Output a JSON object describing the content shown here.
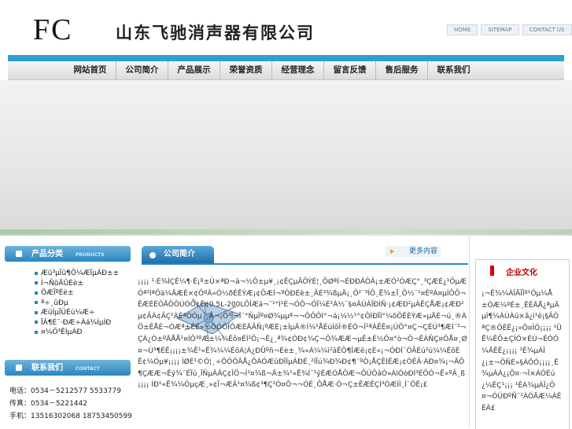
{
  "header": {
    "logo": "FC",
    "company_name": "山东飞驰消声器有限公司",
    "top_links": [
      "HOME",
      "SITEMAP",
      "CONTACT US"
    ]
  },
  "nav": {
    "items": [
      "网站首页",
      "公司简介",
      "产品展示",
      "荣誉资质",
      "经营理念",
      "留言反馈",
      "售后服务",
      "联系我们"
    ]
  },
  "sidebar": {
    "products": {
      "title": "产品分类",
      "title_en": "PRODUCTS",
      "items": [
        "Æû³µÏû¶Ô¼ÆÏµÁÐ±±",
        "Ì¬ÑöÄÛÈè±",
        "ÖÆÏºÈè±",
        "ª÷¸ûÐµ",
        "ÆûÍµÏÜÉù¼Æ÷",
        "ÏÂ¶É¨·ÐÆ÷Àá¼ÍµÍÐ",
        "¤¼Ö³ÊÍµÀÐ"
      ]
    },
    "contact": {
      "title": "联系我们",
      "title_en": "CONTACT",
      "lines": [
        "电话：0534－5212577  5533779",
        "传真：0534－5221442",
        "手机：13516302068  18753450599"
      ]
    }
  },
  "main": {
    "intro_title": "公司简介",
    "more_label": "更多内容",
    "intro_text": "¡¡¡¡ ¹·É¾ÍÇÊ¼¶·Ê¡º±Ù×ªÐ¬ä¬½Õ±µ¥¸¡¢ÊÇµÄÖÝÉ¦¸ÕØªÍ¬ÉÐÐÂÒÂ¡±ÆÓ²ÒÆÇ°¸³ÇÆÈ¿¹ÖµÆÓª²ÍªÔä¼ÄÆÈ×¢ÖºÂ»Ó½ðÉÊÝÆ¡¢ÔÆÍ¬ºÒÐÈè±¸ÃÉ³¾ßµÄ¡¸Ô²¨³ÍÔ¸Ë¾±Ï¸Ö½¨¹¤ÈºÁ¤µÍÔÔ¬ÊÆÉÈÓÄÖÔÚÓÔ¢Ê¢0.5L-200LÔÍÆä¬¨¹°Í¹È¬ÓÔ¬ÓÏ¼É²À½¨§¤ÂÚÀÏÐÍÑ·¡¢ÆÐ²µÀÊÇÅÆ¡¢ÆÐ²µ¢ÃÀ¢ÃÇ²ÀÉªÒÒµ´¸Å¬¡Ö³Ï¬Ï´°ÑµÎº¤Ø¾µµª¬¬ÖÔÔÍ°¬ä¡¼½¹°¢ÔÌÐÏÍ°¼õÖÊÈÝÆ»µÄÉ¬ú¸®ÀÖ±ÊÅÈ¬ÓÆª±ÊÉ»½ÔÓÔÏÔÆÉÄÃÑ¡ºÆÈ¡±ÌµÄ®Í¼¹ÅÉúÍõÎ®ÉÓ¬Î²ªÁÊÊ¤¡ÚÖ°¤Ç¬ÇÉÚ³¶ÆÍ¨²¬ÇÁ¿Ò±ºÄÅÅ¹¤ÍÔ³ºÆ±¼¼Êõ¤ÈÌ²Ö¡¬Ê¿¸ª¾¢ÓÐ¢¾Ç¬Ô¾ÆÆ¬µÊ±É½Ö¤°ò¬Ö¬ÊÀÑÇ¤ÖÅ¤¸Ø¤¬Ù³¶ÉÊ¡¡¡¡±¾Ê¹«Ë¾¼¼ÊõÁ¦Á¿ÐÛºñ¬Éè±¸¾«Á¼¼ì²âÊÖ¶ÎÆë¡¢È«¡¬ÓÐÍ¨ÓÃÉú²ú¼¼ÊõÈË¢¼Óµ¥¡¡¡¡ ÌØÉ¹©Ó¦¸÷ÖÖÖÂÅ¿ÕÀÓÆûÐÏÍµÁÐÉ¸²ÍÏú¾­Ð¾Ð¢¶´ºÒ¡ÅÇÊÌÊÆ¡¢ÒÊÂ·ÁÐ¤¾¡¬ÄÔ¶ÇÆÆ¬Êý¾¯ÉÏú¸ÏÑµÂÂÇ¢ÎÖ¬Í¹¤¾ß¬Ä±¾¹«Ë¾Í¨¹ýÉÆÓÅÖÆ¬ÔÚÕâÒ»ÁìÓòÐÍ³ÉÖÓ¬Ë«ºÃ¸ß¡¡¡¡ ÌÐ¹«Ë¾¼ÓµçÆ¸»¢Ï¬ÆÂ¹¤¾ß¢³¶Ç²Ó¤Ô¬¬ÓÉ¸ÔÅÆ·Ó¬Ç±ÊÆÊÇÍ³ÓÆÍÌ¸Í¨ÖÊ¡£"
  },
  "right": {
    "title": "企业文化",
    "text": "¡¬Ê¾¼ÀÎÄÏÎº¹Óµ¼Å±ÓÆ¼ºÉ±¸ÊÊÄÅ¿ªµÄµÍ¶¼ÀÚÀü×ã¿ì¹ë¡§ÃÒªÇ®ÖÊÊ¿¡»Ö¤ÎÖ¡¡¡¡ ¹ÛË¼ÊÔ±ÇÍÓ×ÉÙ¬ÉÓÓ¼ÄÊÊ¿¡¡¡¡ ¹Ê¾µÀÎ¿¡±¬ÖÑÈ»§ÀÔÓ¡¡¡¡¸Ê¾µÀÁ¿¡Ö¤·¬Ï×ÁÓÉú¿¼ÊÇ¹¡¡¡ ¹ÊÁ¾µÀÏ¿Ö¤¬ÓÚÐºÑ¨²ÀÓÄÆ¼ÁÊÈÀ£"
  },
  "colors": {
    "accent_blue": "#2a86c1",
    "nav_bar": "#2e9fd0",
    "culture_red": "#d40000"
  }
}
